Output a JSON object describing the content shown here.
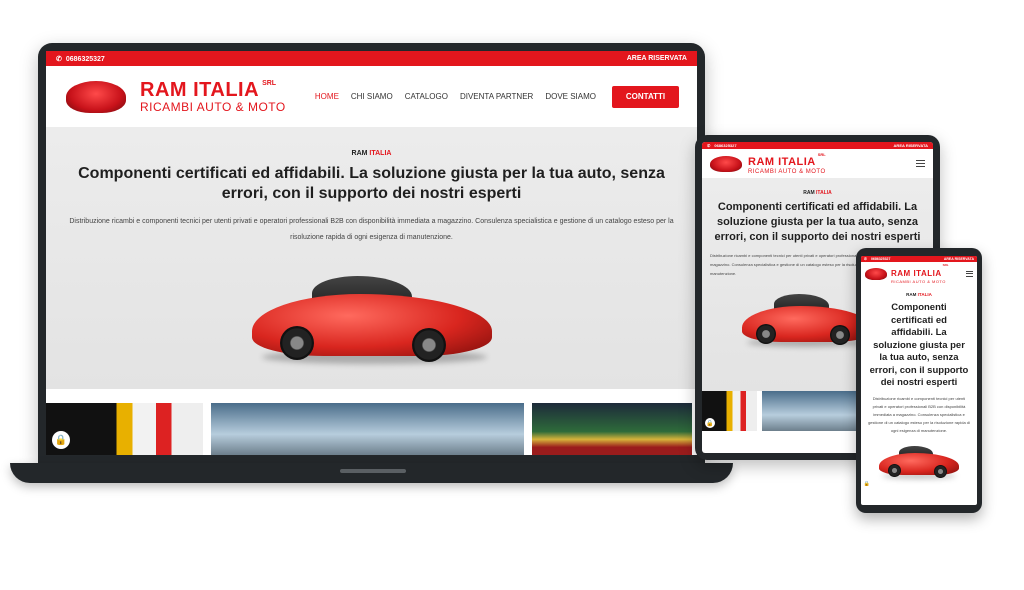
{
  "site": {
    "phone": "0686325327",
    "reserved_area": "AREA RISERVATA",
    "logo": {
      "name": "RAM ITALIA",
      "suffix": "SRL",
      "tagline": "RICAMBI AUTO & MOTO"
    },
    "nav": [
      "HOME",
      "CHI SIAMO",
      "CATALOGO",
      "DIVENTA PARTNER",
      "DOVE SIAMO"
    ],
    "contact_button": "CONTATTI",
    "hero": {
      "eyebrow_a": "RAM",
      "eyebrow_b": "ITALIA",
      "headline": "Componenti certificati ed affidabili. La soluzione giusta per la tua auto, senza errori, con il supporto dei nostri esperti",
      "paragraph": "Distribuzione ricambi e componenti tecnici per utenti privati e operatori professionali B2B con disponibilità immediata a magazzino. Consulenza specialistica e gestione di un catalogo esteso per la risoluzione rapida di ogni esigenza di manutenzione."
    }
  },
  "icons": {
    "phone": "phone-icon",
    "menu": "hamburger-menu-icon",
    "lock": "lock-icon"
  },
  "colors": {
    "brand_red": "#e3161d",
    "device_frame": "#23272a",
    "hero_bg": "#e9e9e9"
  }
}
